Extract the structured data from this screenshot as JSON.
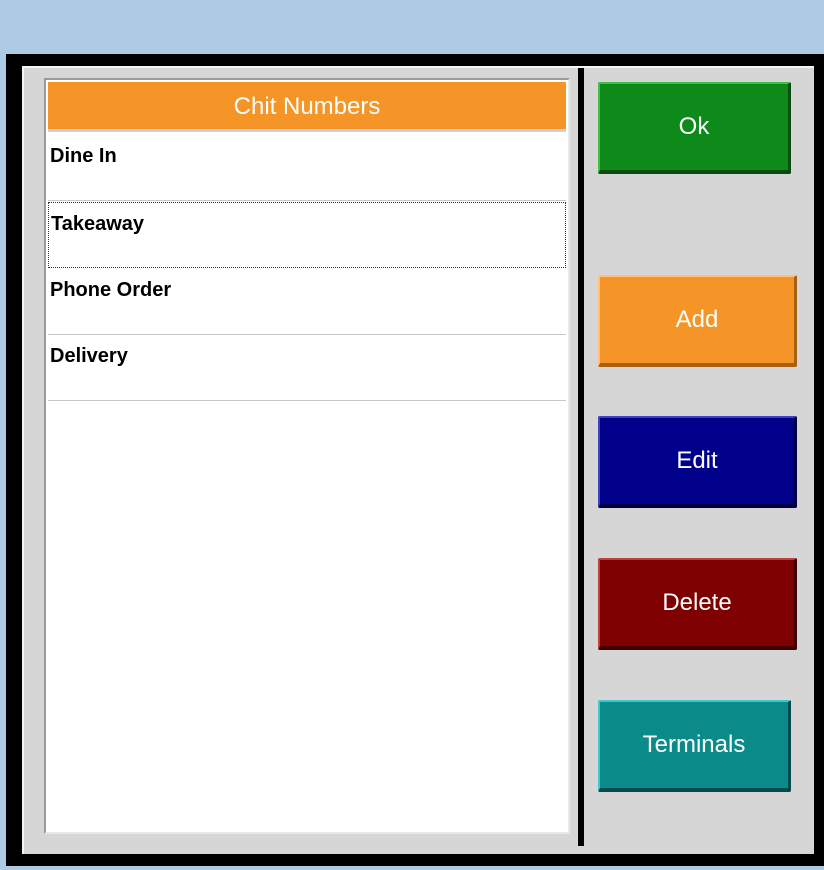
{
  "list": {
    "header": "Chit Numbers",
    "items": [
      {
        "label": "Dine In"
      },
      {
        "label": "Takeaway",
        "selected": true
      },
      {
        "label": "Phone Order"
      },
      {
        "label": "Delivery"
      }
    ]
  },
  "buttons": {
    "ok": "Ok",
    "add": "Add",
    "edit": "Edit",
    "delete": "Delete",
    "terminals": "Terminals"
  },
  "colors": {
    "background": "#aecbe6",
    "header": "#f59527",
    "ok": "#0d8a19",
    "add": "#f59527",
    "edit": "#00008a",
    "delete": "#7e0000",
    "terminals": "#0b8a8a"
  }
}
